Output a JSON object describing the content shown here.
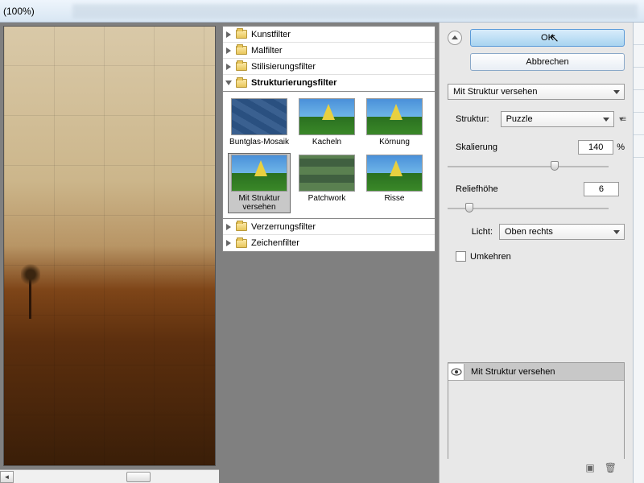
{
  "titlebar": {
    "zoom": "(100%)"
  },
  "tree": {
    "items": [
      {
        "label": "Kunstfilter",
        "open": false
      },
      {
        "label": "Malfilter",
        "open": false
      },
      {
        "label": "Stilisierungsfilter",
        "open": false
      },
      {
        "label": "Strukturierungsfilter",
        "open": true,
        "bold": true
      },
      {
        "label": "Verzerrungsfilter",
        "open": false
      },
      {
        "label": "Zeichenfilter",
        "open": false
      }
    ]
  },
  "thumbs": [
    {
      "label": "Buntglas-Mosaik"
    },
    {
      "label": "Kacheln"
    },
    {
      "label": "Körnung"
    },
    {
      "label": "Mit Struktur versehen"
    },
    {
      "label": "Patchwork"
    },
    {
      "label": "Risse"
    }
  ],
  "buttons": {
    "ok": "OK",
    "cancel": "Abbrechen"
  },
  "settings": {
    "current_filter": "Mit Struktur versehen",
    "texture_label": "Struktur:",
    "texture_value": "Puzzle",
    "scale_label": "Skalierung",
    "scale_value": "140",
    "scale_unit": "%",
    "relief_label": "Reliefhöhe",
    "relief_value": "6",
    "light_label": "Licht:",
    "light_value": "Oben rechts",
    "invert_label": "Umkehren"
  },
  "layer": {
    "name": "Mit Struktur versehen"
  }
}
